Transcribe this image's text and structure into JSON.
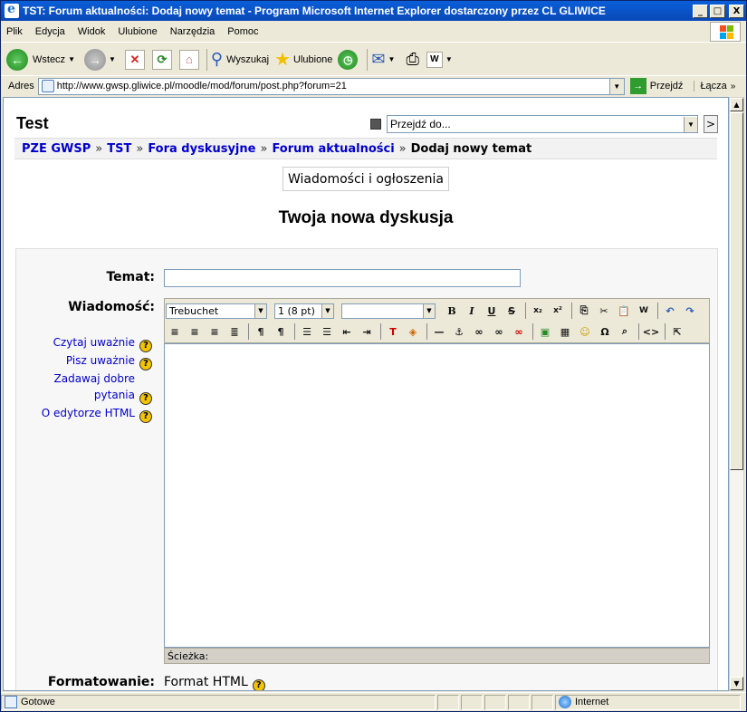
{
  "window": {
    "title": "TST: Forum aktualności: Dodaj nowy temat - Program Microsoft Internet Explorer dostarczony przez CL GLIWICE",
    "minimize": "_",
    "maximize": "□",
    "close": "X"
  },
  "menu": [
    "Plik",
    "Edycja",
    "Widok",
    "Ulubione",
    "Narzędzia",
    "Pomoc"
  ],
  "toolbar": {
    "back": "Wstecz",
    "search": "Wyszukaj",
    "favorites": "Ulubione"
  },
  "address": {
    "label": "Adres",
    "url": "http://www.gwsp.gliwice.pl/moodle/mod/forum/post.php?forum=21",
    "go": "Przejdź",
    "links": "Łącza"
  },
  "page": {
    "site_title": "Test",
    "jump_placeholder": "Przejdź do...",
    "jump_go": ">",
    "breadcrumbs": [
      "PZE GWSP",
      "TST",
      "Fora dyskusyjne",
      "Forum aktualności"
    ],
    "breadcrumb_current": "Dodaj nowy temat",
    "breadcrumb_sep": "»",
    "forum_name": "Wiadomości i ogłoszenia",
    "heading": "Twoja nowa dyskusja",
    "subject_label": "Temat:",
    "message_label": "Wiadomość:",
    "help_links": [
      "Czytaj uważnie",
      "Pisz uważnie",
      "Zadawaj dobre",
      "pytania",
      "O edytorze HTML"
    ],
    "help_icon": "?",
    "editor": {
      "font": "Trebuchet",
      "size": "1 (8 pt)",
      "path_label": "Ścieżka:"
    },
    "format_label": "Formatowanie:",
    "format_value": "Format HTML"
  },
  "status": {
    "text": "Gotowe",
    "zone": "Internet"
  }
}
